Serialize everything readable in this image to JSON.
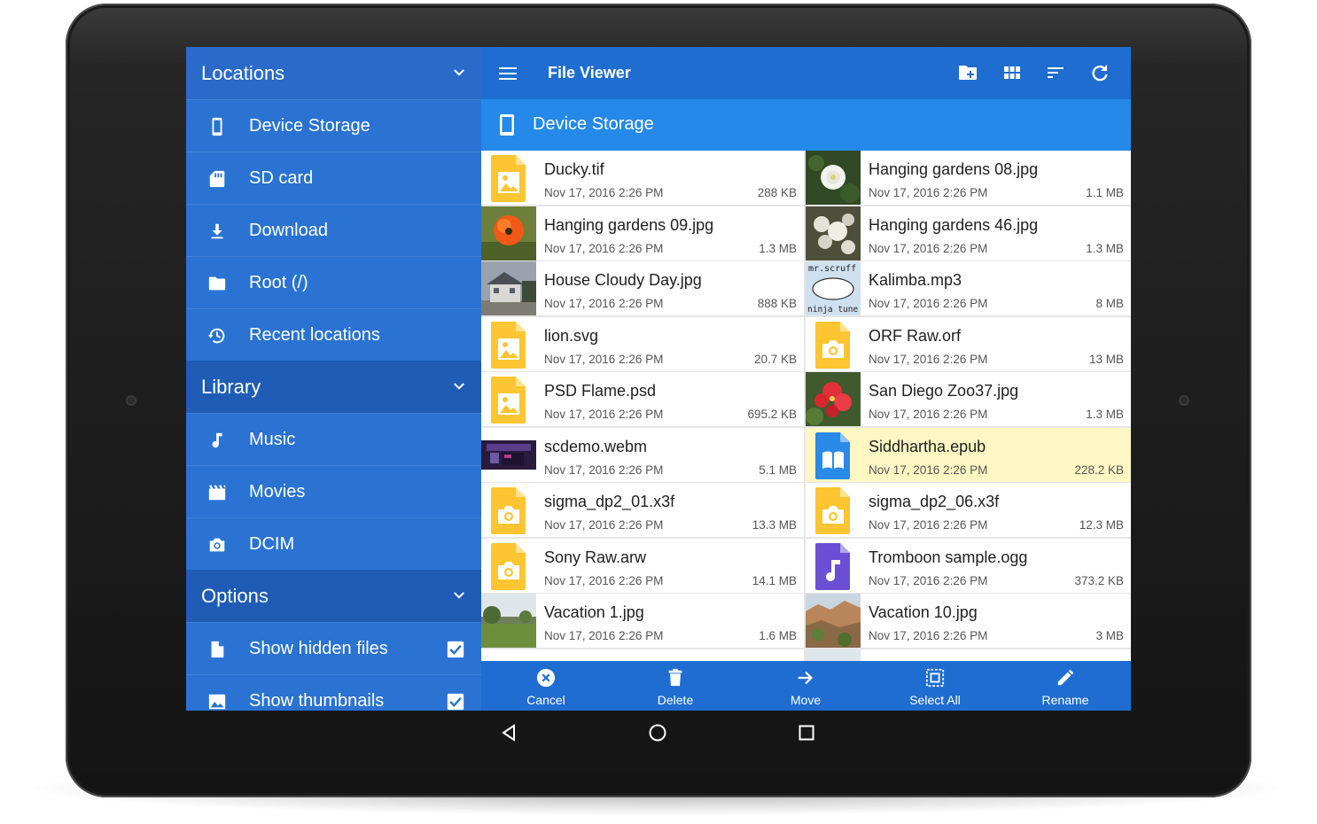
{
  "app": {
    "title": "File Viewer"
  },
  "drawer": {
    "locations": {
      "header": "Locations",
      "items": [
        {
          "label": "Device Storage",
          "icon": "phone-icon"
        },
        {
          "label": "SD card",
          "icon": "sd-card-icon"
        },
        {
          "label": "Download",
          "icon": "download-icon"
        },
        {
          "label": "Root (/)",
          "icon": "folder-icon"
        },
        {
          "label": "Recent locations",
          "icon": "history-icon"
        }
      ]
    },
    "library": {
      "header": "Library",
      "items": [
        {
          "label": "Music",
          "icon": "music-note-icon"
        },
        {
          "label": "Movies",
          "icon": "movie-icon"
        },
        {
          "label": "DCIM",
          "icon": "camera-icon"
        }
      ]
    },
    "options": {
      "header": "Options",
      "items": [
        {
          "label": "Show hidden files",
          "icon": "file-icon",
          "checked": true
        },
        {
          "label": "Show thumbnails",
          "icon": "image-icon",
          "checked": true
        }
      ]
    }
  },
  "toolbar": {
    "actions": [
      "new-folder-icon",
      "grid-view-icon",
      "sort-icon",
      "refresh-icon"
    ]
  },
  "breadcrumb": {
    "label": "Device Storage"
  },
  "files": [
    {
      "name": "Ducky.tif",
      "date": "Nov 17, 2016 2:26 PM",
      "size": "288 KB",
      "thumb": "image-file"
    },
    {
      "name": "Hanging gardens 08.jpg",
      "date": "Nov 17, 2016 2:26 PM",
      "size": "1.1 MB",
      "thumb": "photo-white-flower"
    },
    {
      "name": "Hanging gardens 09.jpg",
      "date": "Nov 17, 2016 2:26 PM",
      "size": "1.3 MB",
      "thumb": "photo-orange-flower"
    },
    {
      "name": "Hanging gardens 46.jpg",
      "date": "Nov 17, 2016 2:26 PM",
      "size": "1.3 MB",
      "thumb": "photo-white-blossoms"
    },
    {
      "name": "House Cloudy Day.jpg",
      "date": "Nov 17, 2016 2:26 PM",
      "size": "888 KB",
      "thumb": "photo-house"
    },
    {
      "name": "Kalimba.mp3",
      "date": "Nov 17, 2016 2:26 PM",
      "size": "8 MB",
      "thumb": "album-art"
    },
    {
      "name": "lion.svg",
      "date": "Nov 17, 2016 2:26 PM",
      "size": "20.7 KB",
      "thumb": "image-file"
    },
    {
      "name": "ORF Raw.orf",
      "date": "Nov 17, 2016 2:26 PM",
      "size": "13 MB",
      "thumb": "camera-file"
    },
    {
      "name": "PSD Flame.psd",
      "date": "Nov 17, 2016 2:26 PM",
      "size": "695.2 KB",
      "thumb": "image-file"
    },
    {
      "name": "San Diego Zoo37.jpg",
      "date": "Nov 17, 2016 2:26 PM",
      "size": "1.3 MB",
      "thumb": "photo-red-flower"
    },
    {
      "name": "scdemo.webm",
      "date": "Nov 17, 2016 2:26 PM",
      "size": "5.1 MB",
      "thumb": "video-frame"
    },
    {
      "name": "Siddhartha.epub",
      "date": "Nov 17, 2016 2:26 PM",
      "size": "228.2 KB",
      "thumb": "book-file",
      "selected": true
    },
    {
      "name": "sigma_dp2_01.x3f",
      "date": "Nov 17, 2016 2:26 PM",
      "size": "13.3 MB",
      "thumb": "camera-file"
    },
    {
      "name": "sigma_dp2_06.x3f",
      "date": "Nov 17, 2016 2:26 PM",
      "size": "12.3 MB",
      "thumb": "camera-file"
    },
    {
      "name": "Sony Raw.arw",
      "date": "Nov 17, 2016 2:26 PM",
      "size": "14.1 MB",
      "thumb": "camera-file"
    },
    {
      "name": "Tromboon sample.ogg",
      "date": "Nov 17, 2016 2:26 PM",
      "size": "373.2 KB",
      "thumb": "audio-file"
    },
    {
      "name": "Vacation 1.jpg",
      "date": "Nov 17, 2016 2:26 PM",
      "size": "1.6 MB",
      "thumb": "photo-field"
    },
    {
      "name": "Vacation 10.jpg",
      "date": "Nov 17, 2016 2:26 PM",
      "size": "3 MB",
      "thumb": "photo-canyon"
    }
  ],
  "bottom_actions": [
    {
      "label": "Cancel",
      "icon": "cancel-icon"
    },
    {
      "label": "Delete",
      "icon": "delete-icon"
    },
    {
      "label": "Move",
      "icon": "arrow-right-icon"
    },
    {
      "label": "Select All",
      "icon": "select-all-icon"
    },
    {
      "label": "Rename",
      "icon": "pencil-icon"
    }
  ],
  "nav": [
    "back-icon",
    "home-icon",
    "recents-icon"
  ],
  "colors": {
    "appbar": "#1f6dd0",
    "breadcrumb": "#2489e8",
    "drawer": "#2569c3",
    "selected_row": "#fdf7c3",
    "file_icon_yellow": "#fcc531",
    "file_icon_blue": "#2a8ae8",
    "file_icon_purple": "#6a4fd4"
  }
}
